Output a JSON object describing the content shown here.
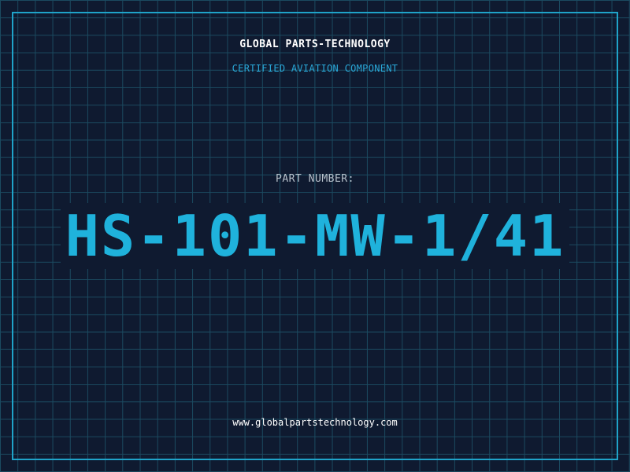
{
  "company_name": "GLOBAL PARTS-TECHNOLOGY",
  "tagline": "CERTIFIED AVIATION COMPONENT",
  "part_label": "PART NUMBER:",
  "part_number": "HS-101-MW-1/41",
  "website": "www.globalpartstechnology.com",
  "colors": {
    "background": "#0f1a30",
    "grid": "#1b4a60",
    "accent": "#1fb2dc",
    "frame": "#1fa3c8",
    "text": "#ffffff",
    "label": "#b8c2cc"
  }
}
